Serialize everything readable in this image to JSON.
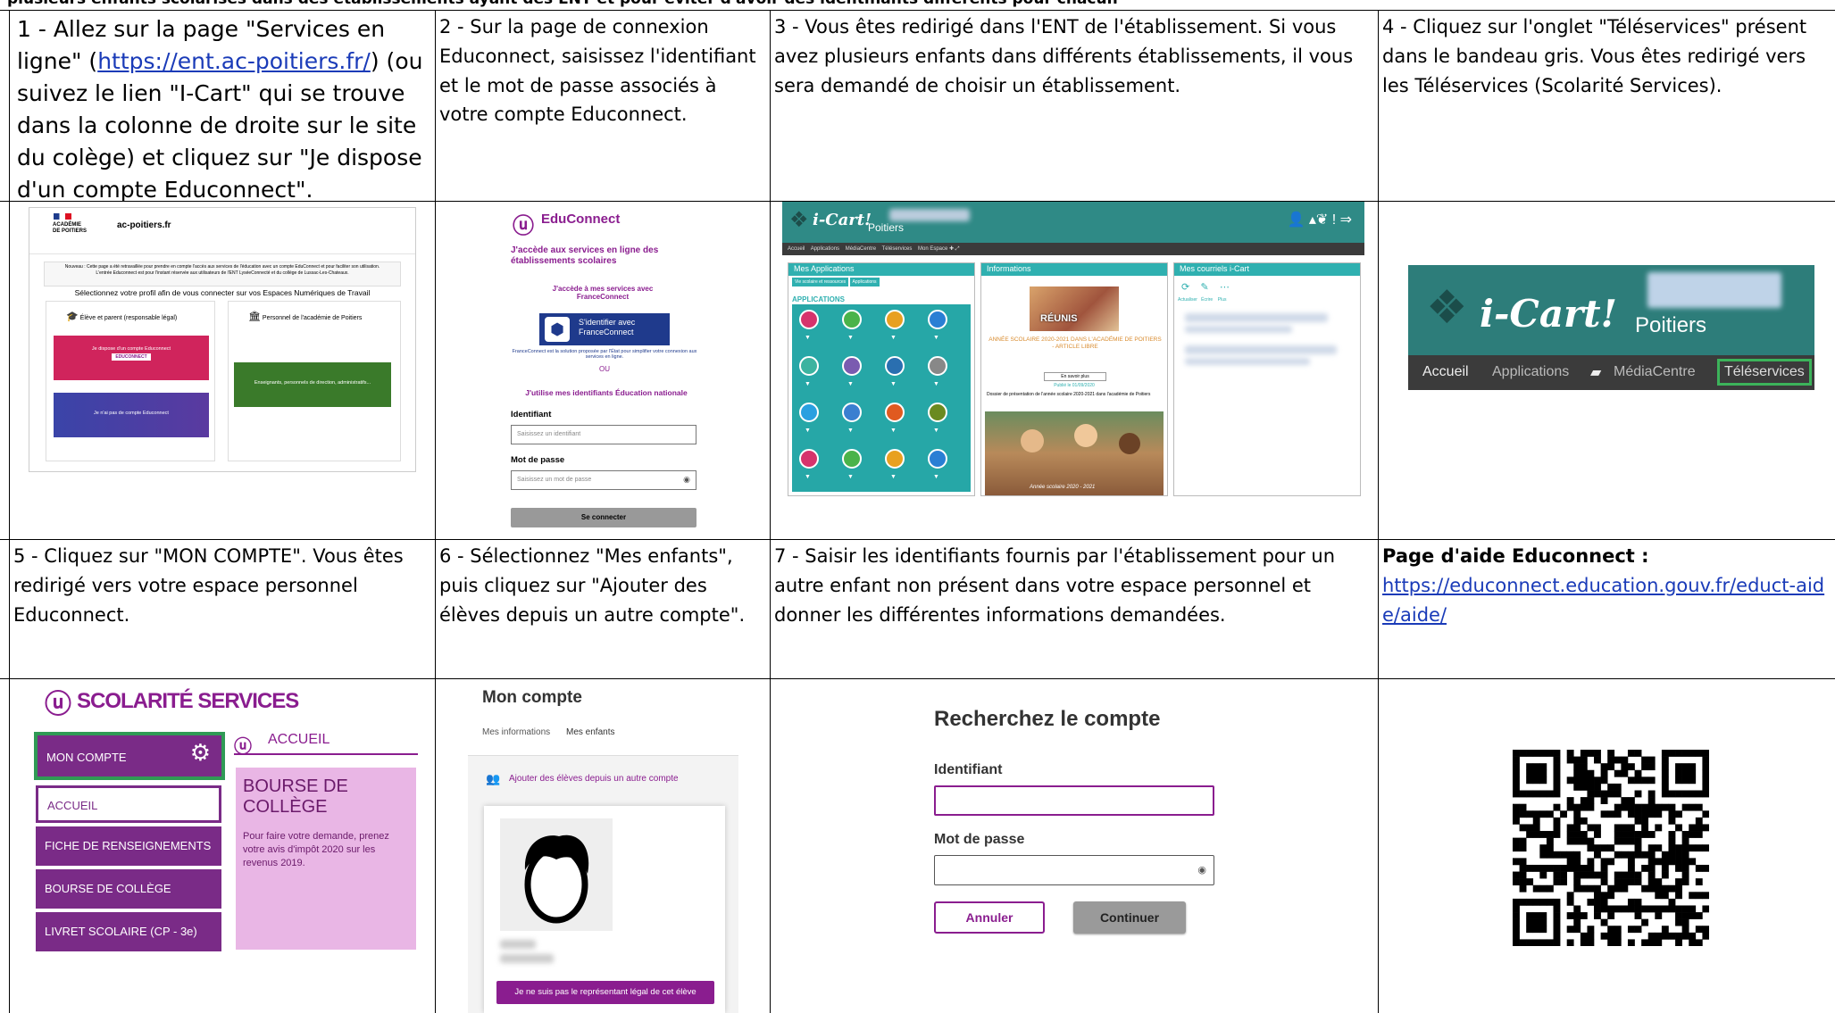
{
  "top_text": "plusieurs enfants scolarisés dans des établissements ayant des ENT et pour éviter d'avoir des identifiants différents pour chacun",
  "steps": {
    "s1": {
      "before": "1 - Allez sur la page \"Services en ligne\" (",
      "link": "https://ent.ac-poitiers.fr/",
      "after": ") (ou suivez le lien \"I-Cart\" qui se trouve dans la colonne de droite sur le site du colège) et cliquez sur \"Je dispose d'un compte Educonnect\"."
    },
    "s2": "2 - Sur la page de connexion Educonnect, saisissez l'identifiant et le mot de passe associés à votre compte Educonnect.",
    "s3": "3 - Vous êtes redirigé dans l'ENT de l'établissement. Si vous avez plusieurs enfants dans différents établissements, il vous sera demandé de choisir un établissement.",
    "s4": "4 - Cliquez sur l'onglet \"Téléservices\" présent dans le bandeau gris. Vous êtes redirigé vers les Téléservices (Scolarité Services).",
    "s5": "5 - Cliquez sur \"MON COMPTE\". Vous êtes redirigé vers votre espace personnel Educonnect.",
    "s6": "6 - Sélectionnez \"Mes enfants\", puis cliquez sur \"Ajouter des élèves depuis un autre compte\".",
    "s7": "7 - Saisir les identifiants fournis par l'établissement pour un autre enfant non présent dans votre espace personnel et donner les différentes informations demandées.",
    "help_title": "Page d'aide Educonnect :",
    "help_link": "https://educonnect.education.gouv.fr/educt-aide/aide/"
  },
  "shot1": {
    "academie": "ACADÉMIE DE POITIERS",
    "site": "ac-poitiers.fr",
    "notice": "Nouveau : Cette page a été retravaillée pour prendre en compte l'accès aux services de l'éducation avec un compte EduConnect et pour faciliter son utilisation.",
    "notice2": "L'entrée Educonnect est pour l'instant réservée aux utilisateurs de l'ENT LyséeConnecté et du collège de Lussac-Les-Chateaux.",
    "select_profile": "Sélectionnez votre profil afin de vous connecter sur vos Espaces Numériques de Travail",
    "col_left": "Élève et parent (responsable légal)",
    "col_right": "Personnel de l'académie de Poitiers",
    "btn_have": "Je dispose d'un compte Educonnect",
    "btn_have_logo": "EDUCONNECT",
    "btn_none": "Je n'ai pas de compte Educonnect",
    "btn_staff": "Enseignants, personnels de direction, administratifs..."
  },
  "shot2": {
    "brand": "EduConnect",
    "title": "J'accède aux services en ligne des établissements scolaires",
    "fc_intro": "J'accède à mes services avec FranceConnect",
    "fc_button": "S'identifier avec FranceConnect",
    "fc_desc": "FranceConnect est la solution proposée par l'État pour simplifier votre connexion aux services en ligne.",
    "ou": "OU",
    "use_ids": "J'utilise mes identifiants Éducation nationale",
    "id_label": "Identifiant",
    "id_placeholder": "Saisissez un identifiant",
    "pw_label": "Mot de passe",
    "pw_placeholder": "Saisissez un mot de passe",
    "submit": "Se connecter"
  },
  "shot3": {
    "brand": "i-Cart!",
    "sub": "Poitiers",
    "nav": [
      "Accueil",
      "Applications",
      "MédiaCentre",
      "Téléservices",
      "Mon Espace"
    ],
    "panel1": "Mes Applications",
    "panel1_tabs": [
      "Vie scolaire et ressources",
      "Applications"
    ],
    "apps_heading": "APPLICATIONS",
    "panel2": "Informations",
    "reunis": "RÉUNIS",
    "info_title": "ANNÉE SCOLAIRE 2020-2021 DANS L'ACADÉMIE DE POITIERS - ARTICLE LIBRE",
    "info_more": "En savoir plus",
    "info_date": "Publié le 01/09/2020",
    "info_desc": "Dossier de présentation de l'année scolaire 2020-2021 dans l'académie de Poitiers",
    "photo_caption": "Année scolaire 2020 - 2021",
    "panel3": "Mes courriels i-Cart",
    "mail_actions": [
      "Actualiser",
      "Écrire",
      "Plus"
    ]
  },
  "shot4": {
    "brand": "i-Cart!",
    "sub": "Poitiers",
    "nav": [
      "Accueil",
      "Applications",
      "MédiaCentre",
      "Téléservices"
    ]
  },
  "shot5": {
    "brand": "SCOLARITÉ SERVICES",
    "menu": [
      "MON COMPTE",
      "ACCUEIL",
      "FICHE DE RENSEIGNEMENTS",
      "BOURSE DE COLLÈGE",
      "LIVRET SCOLAIRE (CP - 3e)"
    ],
    "accueil": "ACCUEIL",
    "card_title": "BOURSE DE COLLÈGE",
    "card_text": "Pour faire votre demande, prenez votre avis d'impôt 2020 sur les revenus 2019."
  },
  "shot6": {
    "title": "Mon compte",
    "tabs": [
      "Mes informations",
      "Mes enfants"
    ],
    "add_link": "Ajouter des élèves depuis un autre compte",
    "not_legal": "Je ne suis pas le représentant légal de cet élève"
  },
  "shot7": {
    "title": "Recherchez le compte",
    "id_label": "Identifiant",
    "pw_label": "Mot de passe",
    "cancel": "Annuler",
    "continue": "Continuer"
  },
  "colors": {
    "educonnect": "#8a1d8f",
    "icart": "#2f8a86",
    "navgray": "#3b3b3b",
    "scolarite": "#7a2b87",
    "link": "#1a3bb8"
  }
}
